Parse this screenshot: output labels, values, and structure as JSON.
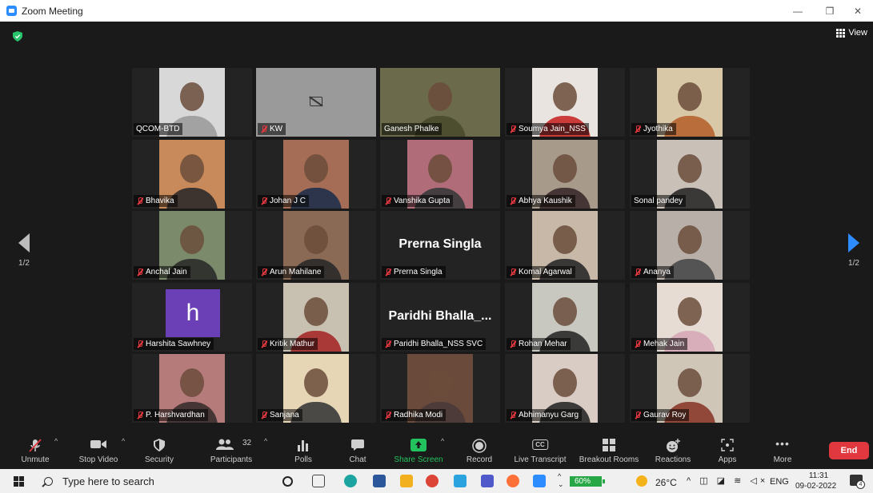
{
  "window": {
    "title": "Zoom Meeting"
  },
  "view_label": "View",
  "pager": {
    "left": "1/2",
    "right": "1/2"
  },
  "participants": [
    {
      "name": "QCOM-BTD",
      "muted": false,
      "bg": "#d8d8d8",
      "shirt": "#9c9c9c"
    },
    {
      "name": "KW",
      "muted": true,
      "cam_off": true,
      "bg": "#9a9a9a"
    },
    {
      "name": "Ganesh Phalke",
      "muted": false,
      "active": true,
      "bg": "#6b6a4a",
      "shirt": "#4a4a2e"
    },
    {
      "name": "Soumya Jain_NSS",
      "muted": true,
      "bg": "#e9e4df",
      "shirt": "#c62828"
    },
    {
      "name": "Jyothika",
      "muted": true,
      "bg": "#d9c8a8",
      "shirt": "#b5632e"
    },
    {
      "name": "Bhavika",
      "muted": true,
      "bg": "#c88a5a",
      "shirt": "#2f2a2a"
    },
    {
      "name": "Johan J C",
      "muted": true,
      "bg": "#a56d55",
      "shirt": "#1f2f4a"
    },
    {
      "name": "Vanshika Gupta",
      "muted": true,
      "bg": "#b06c78",
      "shirt": "#3a3a3a"
    },
    {
      "name": "Abhya Kaushik",
      "muted": true,
      "bg": "#a89a8a",
      "shirt": "#3a2a2a"
    },
    {
      "name": "Sonal pandey",
      "muted": false,
      "bg": "#c9c0b8",
      "shirt": "#2a2a2a"
    },
    {
      "name": "Anchal Jain",
      "muted": true,
      "bg": "#7a8a6a",
      "shirt": "#2b2b2b"
    },
    {
      "name": "Arun Mahilane",
      "muted": true,
      "bg": "#8a6a55",
      "shirt": "#2a2a2a"
    },
    {
      "name": "Prerna Singla",
      "muted": true,
      "text_only": "Prerna Singla"
    },
    {
      "name": "Komal Agarwal",
      "muted": true,
      "bg": "#c8b8a8",
      "shirt": "#2a2a2a"
    },
    {
      "name": "Ananya",
      "muted": true,
      "bg": "#b8b0a8",
      "shirt": "#4a4a4a"
    },
    {
      "name": "Harshita Sawhney",
      "muted": true,
      "avatar_letter": "h"
    },
    {
      "name": "Kritik Mathur",
      "muted": true,
      "bg": "#c8c0b0",
      "shirt": "#a52a2a"
    },
    {
      "name": "Paridhi Bhalla_NSS SVC",
      "muted": true,
      "text_only": "Paridhi  Bhalla_..."
    },
    {
      "name": "Rohan Mehar",
      "muted": true,
      "bg": "#c8c8c0",
      "shirt": "#2a2a2a"
    },
    {
      "name": "Mehak Jain",
      "muted": true,
      "bg": "#e6dcd4",
      "shirt": "#d7a8b8"
    },
    {
      "name": "P. Harshvardhan",
      "muted": true,
      "bg": "#b57a7a",
      "shirt": "#3a2e2e"
    },
    {
      "name": "Sanjana",
      "muted": true,
      "bg": "#e6d6b6",
      "shirt": "#3a3a3a"
    },
    {
      "name": "Radhika Modi",
      "muted": true,
      "bg": "#6a4a3a",
      "shirt": "#4a3a3a"
    },
    {
      "name": "Abhimanyu Garg",
      "muted": true,
      "bg": "#d8ccc4",
      "shirt": "#2a2a2a"
    },
    {
      "name": "Gaurav Roy",
      "muted": true,
      "bg": "#cfc6b8",
      "shirt": "#8a3a2a"
    }
  ],
  "toolbar": {
    "unmute": "Unmute",
    "stop_video": "Stop Video",
    "security": "Security",
    "participants": "Participants",
    "participants_count": "32",
    "polls": "Polls",
    "chat": "Chat",
    "share_screen": "Share Screen",
    "record": "Record",
    "live_transcript": "Live Transcript",
    "breakout_rooms": "Breakout Rooms",
    "reactions": "Reactions",
    "apps": "Apps",
    "more": "More",
    "end": "End",
    "cc_label": "CC"
  },
  "taskbar": {
    "search_placeholder": "Type here to search",
    "battery": "60%",
    "temperature": "26°C",
    "language": "ENG",
    "time": "11:31",
    "date": "09-02-2022",
    "notifications": "4"
  },
  "colors": {
    "share_green": "#22c35e",
    "end_red": "#e0383e",
    "active_speaker": "#c7e25a",
    "zoom_blue": "#2d8cff"
  }
}
